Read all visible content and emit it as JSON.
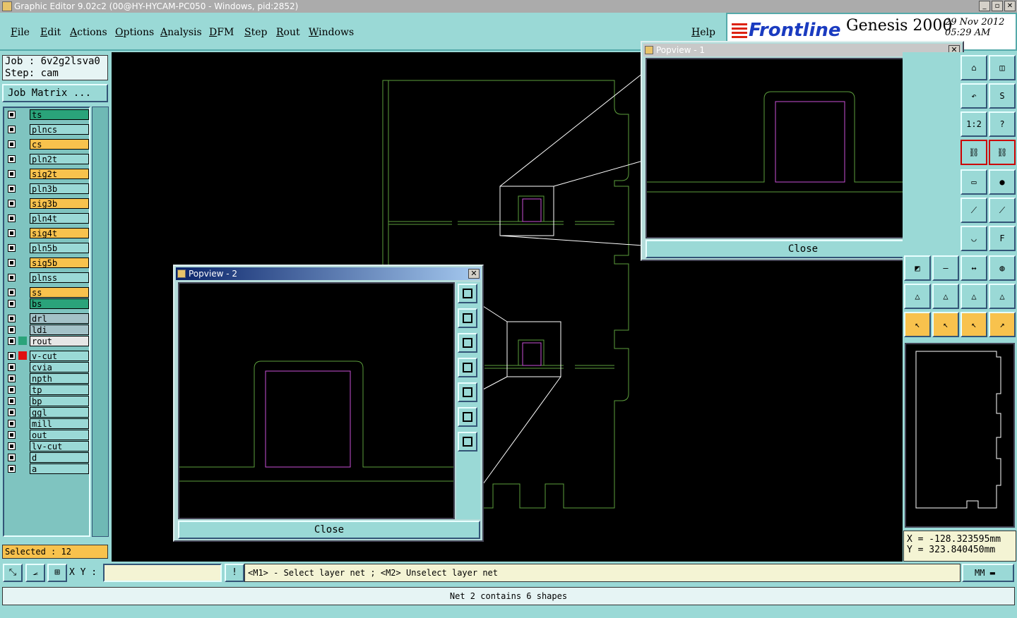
{
  "window": {
    "title": "Graphic Editor 9.02c2 (00@HY-HYCAM-PC050 - Windows, pid:2852)",
    "buttons": [
      "_",
      "▫",
      "✕"
    ]
  },
  "menu": {
    "items": [
      "File",
      "Edit",
      "Actions",
      "Options",
      "Analysis",
      "DFM",
      "Step",
      "Rout",
      "Windows"
    ],
    "help": "Help"
  },
  "brand": {
    "logo": "Frontline",
    "product": "Genesis 2000",
    "date": "29 Nov 2012",
    "time": "05:29 AM"
  },
  "job": {
    "job_line": "Job : 6v2g2lsva0",
    "step_line": "Step: cam",
    "matrix_button": "Job Matrix ..."
  },
  "layers": [
    {
      "name": "ts",
      "color": "green"
    },
    {
      "name": "plncs",
      "color": "cyan"
    },
    {
      "name": "cs",
      "color": "orange"
    },
    {
      "name": "pln2t",
      "color": "cyan"
    },
    {
      "name": "sig2t",
      "color": "orange"
    },
    {
      "name": "pln3b",
      "color": "cyan"
    },
    {
      "name": "sig3b",
      "color": "orange"
    },
    {
      "name": "pln4t",
      "color": "cyan"
    },
    {
      "name": "sig4t",
      "color": "orange"
    },
    {
      "name": "pln5b",
      "color": "cyan"
    },
    {
      "name": "sig5b",
      "color": "orange"
    },
    {
      "name": "plnss",
      "color": "cyan"
    },
    {
      "name": "ss",
      "color": "orange"
    },
    {
      "name": "bs",
      "color": "green"
    },
    {
      "name": "drl",
      "color": "gray"
    },
    {
      "name": "ldi",
      "color": "gray"
    },
    {
      "name": "rout",
      "color": "white"
    },
    {
      "name": "v-cut",
      "color": "cyan"
    },
    {
      "name": "cvia",
      "color": "cyan"
    },
    {
      "name": "npth",
      "color": "cyan"
    },
    {
      "name": "tp",
      "color": "cyan"
    },
    {
      "name": "bp",
      "color": "cyan"
    },
    {
      "name": "ggl",
      "color": "cyan"
    },
    {
      "name": "mill",
      "color": "cyan"
    },
    {
      "name": "out",
      "color": "cyan"
    },
    {
      "name": "lv-cut",
      "color": "cyan"
    },
    {
      "name": "d",
      "color": "cyan"
    },
    {
      "name": "a",
      "color": "cyan"
    }
  ],
  "selected": "Selected : 12",
  "popview1": {
    "title": "Popview - 1",
    "close_label": "Close"
  },
  "popview2": {
    "title": "Popview - 2",
    "close_label": "Close"
  },
  "coords": {
    "x": "X = -128.323595mm",
    "y": "Y = 323.840450mm"
  },
  "bottom": {
    "xy_label": "X Y :",
    "xy_value": "",
    "hint": "<M1> - Select layer net ; <M2> Unselect layer net",
    "units": "MM"
  },
  "status": "Net 2 contains 6 shapes",
  "colors": {
    "board_outline": "#5c9e3c",
    "rout_shape": "#c94fd6",
    "zoom_lines": "#ffffff",
    "active_layer": "#2aa37a",
    "selected_layer": "#f8c24d"
  }
}
